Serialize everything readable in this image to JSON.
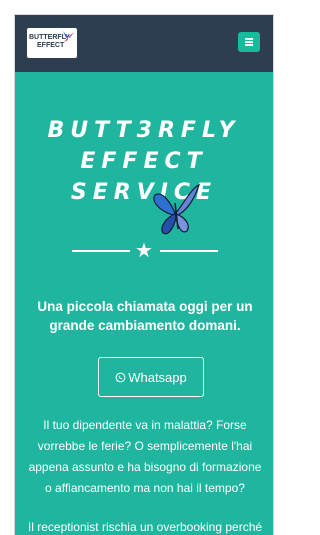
{
  "header": {
    "logo_line1": "BUTTERFLY",
    "logo_line2": "EFFECT",
    "menu_icon": "hamburger-icon"
  },
  "hero": {
    "title_line1": "BUTT3RFLY",
    "title_line2": "EFFECT",
    "title_line3": "SERVICE",
    "tagline": "Una piccola chiamata oggi per un grande cambiamento domani.",
    "whatsapp_label": "Whatsapp"
  },
  "content": {
    "paragraph1": "Il tuo dipendente va in malattia? Forse vorrebbe le ferie? O semplicemente l'hai appena assunto e ha bisogno di formazione o affiancamento ma non hai il tempo?",
    "paragraph2": "Il receptionist rischia un overbooking perché"
  },
  "colors": {
    "navbar": "#2c3e50",
    "background": "#1fb59f",
    "accent": "#18bc9c",
    "text": "#ffffff"
  }
}
